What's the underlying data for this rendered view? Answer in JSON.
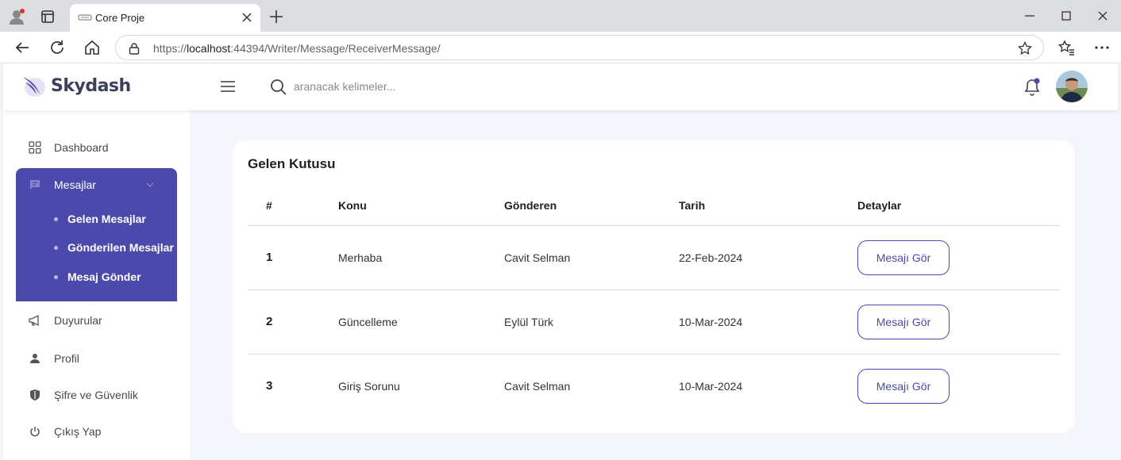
{
  "browser": {
    "tab_title": "Core Proje",
    "url_prefix": "https://",
    "url_host": "localhost",
    "url_rest": ":44394/Writer/Message/ReceiverMessage/"
  },
  "header": {
    "brand": "Skydash",
    "search_placeholder": "aranacak kelimeler..."
  },
  "sidebar": {
    "dashboard": "Dashboard",
    "messages": {
      "label": "Mesajlar",
      "children": [
        "Gelen Mesajlar",
        "Gönderilen Mesajlar",
        "Mesaj Gönder"
      ]
    },
    "announcements": "Duyurular",
    "profile": "Profil",
    "password_security": "Şifre ve Güvenlik",
    "logout": "Çıkış Yap"
  },
  "inbox": {
    "title": "Gelen Kutusu",
    "columns": [
      "#",
      "Konu",
      "Gönderen",
      "Tarih",
      "Detaylar"
    ],
    "rows": [
      {
        "no": "1",
        "subject": "Merhaba",
        "sender": "Cavit Selman",
        "date": "22-Feb-2024",
        "action": "Mesajı Gör"
      },
      {
        "no": "2",
        "subject": "Güncelleme",
        "sender": "Eylül Türk",
        "date": "10-Mar-2024",
        "action": "Mesajı Gör"
      },
      {
        "no": "3",
        "subject": "Giriş Sorunu",
        "sender": "Cavit Selman",
        "date": "10-Mar-2024",
        "action": "Mesajı Gör"
      }
    ]
  },
  "colors": {
    "accent": "#4b49ac",
    "page_bg": "#f4f6fc",
    "notification_dot": "#4b49ac"
  },
  "icons": {
    "browser": [
      "profile-icon",
      "tabs-icon",
      "close-icon",
      "plus-icon",
      "minimize-icon",
      "maximize-icon",
      "window-close-icon",
      "back-icon",
      "reload-icon",
      "home-icon",
      "lock-icon",
      "star-icon",
      "favorites-icon",
      "more-icon"
    ],
    "app": [
      "logo-icon",
      "menu-icon",
      "search-icon",
      "bell-icon",
      "grid-icon",
      "message-icon",
      "chevron-down-icon",
      "megaphone-icon",
      "user-icon",
      "shield-icon",
      "power-icon"
    ]
  }
}
